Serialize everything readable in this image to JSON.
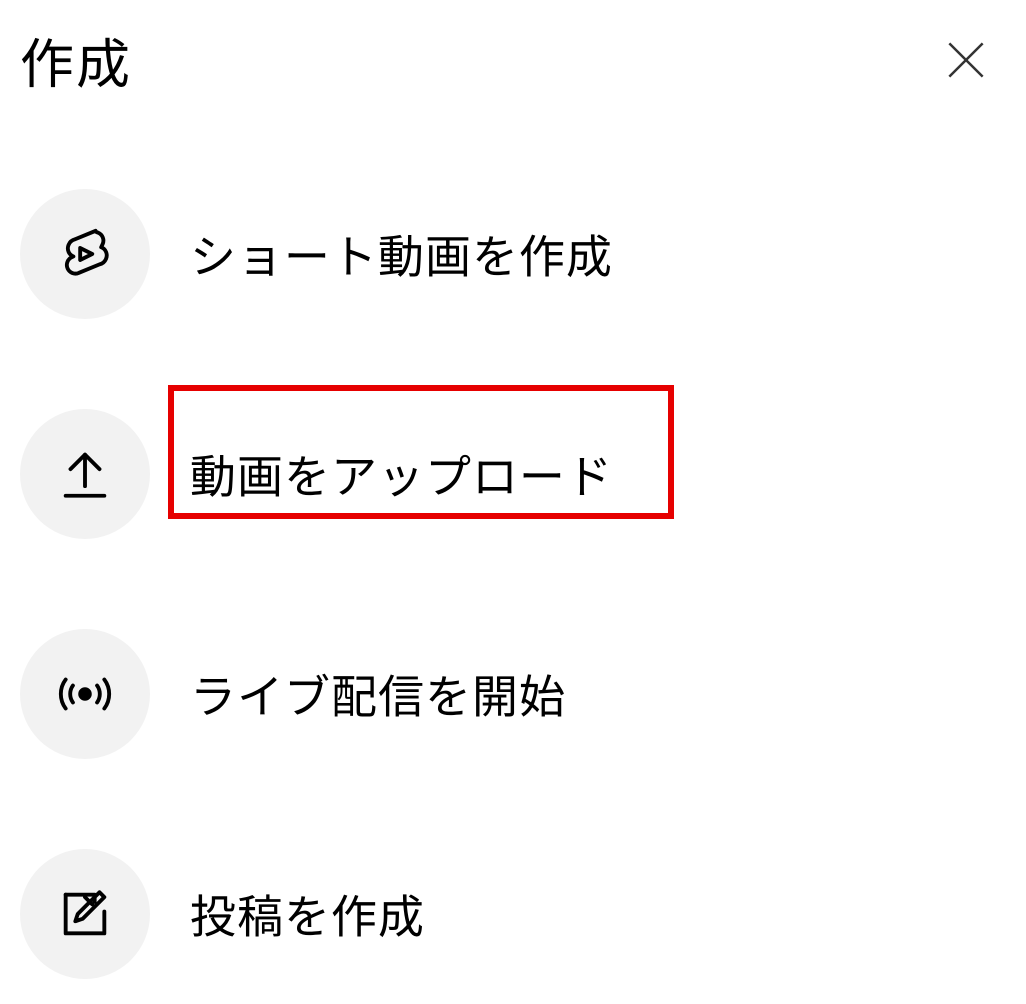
{
  "header": {
    "title": "作成"
  },
  "menu": {
    "items": [
      {
        "label": "ショート動画を作成",
        "icon": "shorts-icon",
        "highlighted": false
      },
      {
        "label": "動画をアップロード",
        "icon": "upload-icon",
        "highlighted": true
      },
      {
        "label": "ライブ配信を開始",
        "icon": "live-icon",
        "highlighted": false
      },
      {
        "label": "投稿を作成",
        "icon": "post-icon",
        "highlighted": false
      }
    ]
  }
}
